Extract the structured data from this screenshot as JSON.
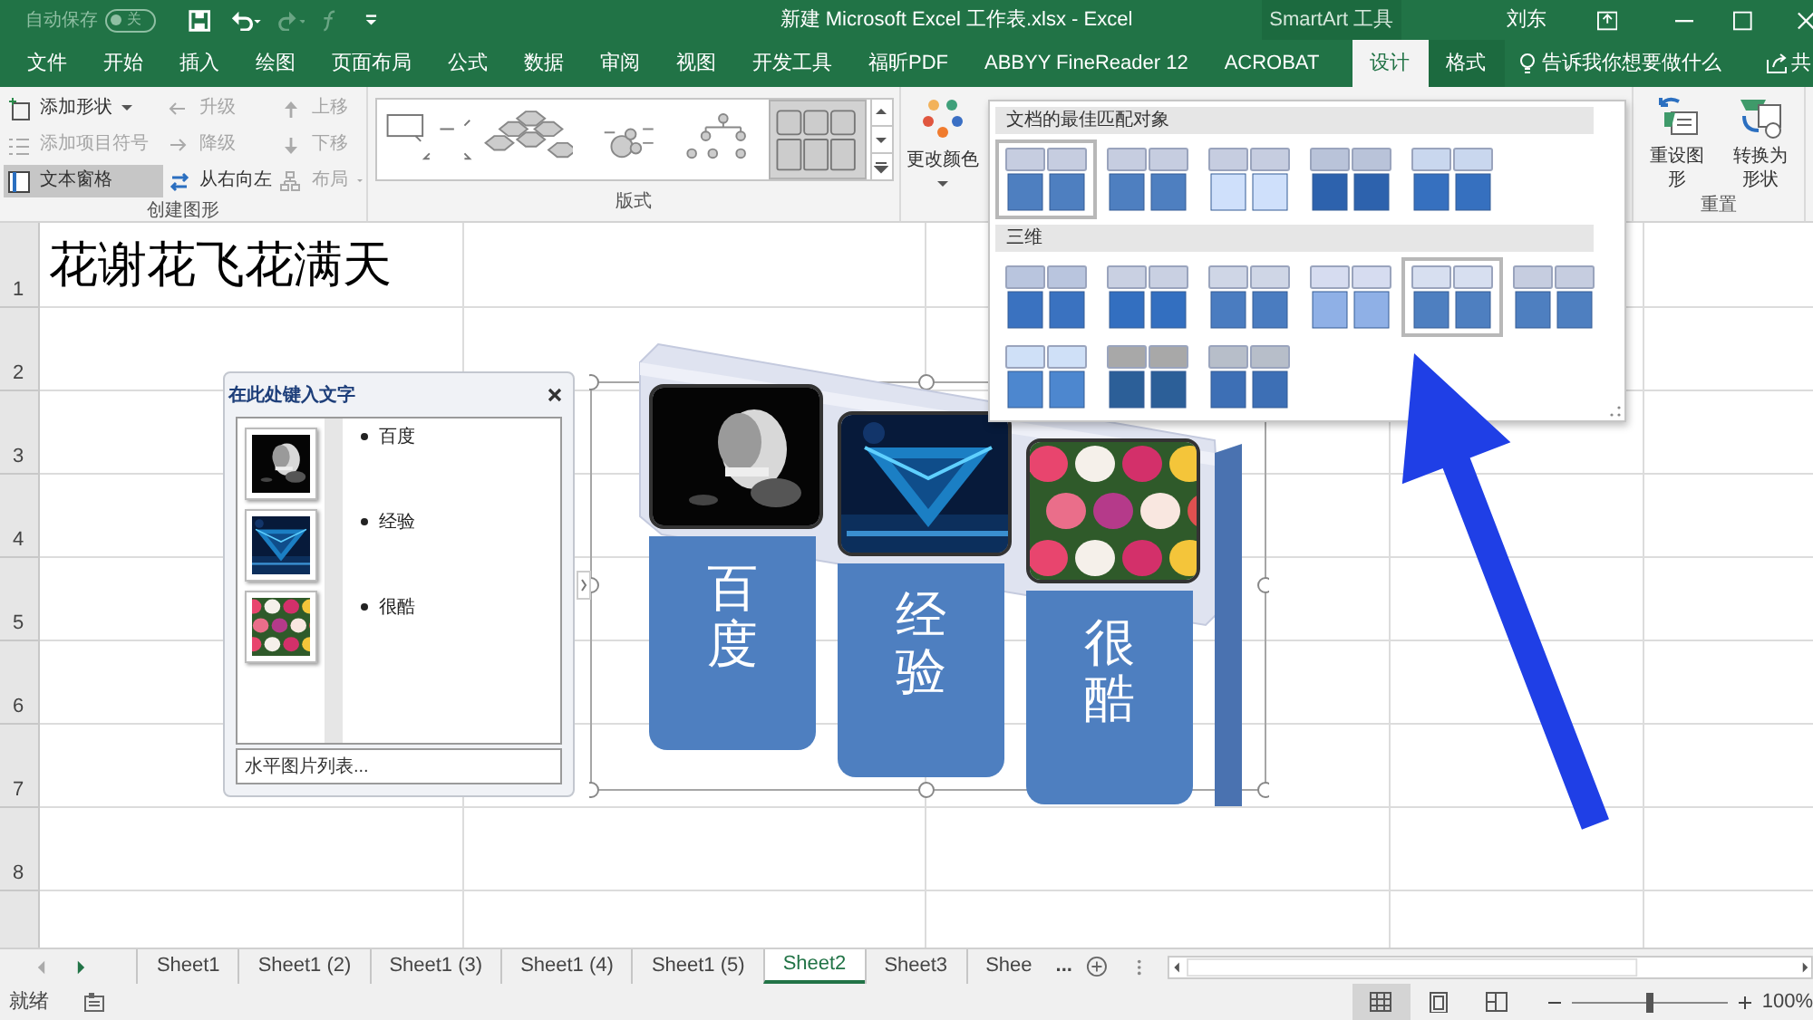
{
  "title_bar": {
    "autosave_label": "自动保存",
    "autosave_state": "关",
    "autosave_on": false,
    "title": "新建 Microsoft Excel 工作表.xlsx  -  Excel",
    "contextual_title": "SmartArt 工具",
    "user": "刘东"
  },
  "tabs": [
    {
      "label": "文件",
      "selected": false
    },
    {
      "label": "开始",
      "selected": false
    },
    {
      "label": "插入",
      "selected": false
    },
    {
      "label": "绘图",
      "selected": false
    },
    {
      "label": "页面布局",
      "selected": false
    },
    {
      "label": "公式",
      "selected": false
    },
    {
      "label": "数据",
      "selected": false
    },
    {
      "label": "审阅",
      "selected": false
    },
    {
      "label": "视图",
      "selected": false
    },
    {
      "label": "开发工具",
      "selected": false
    },
    {
      "label": "福昕PDF",
      "selected": false
    },
    {
      "label": "ABBYY FineReader 12",
      "selected": false
    },
    {
      "label": "ACROBAT",
      "selected": false
    }
  ],
  "contextual_tabs": [
    {
      "label": "设计",
      "selected": true
    },
    {
      "label": "格式",
      "selected": false
    }
  ],
  "tell_me": "告诉我你想要做什么",
  "share": "共",
  "ribbon": {
    "create_group": {
      "label": "创建图形",
      "commands": [
        {
          "label": "添加形状",
          "disabled": false,
          "on": false,
          "dropdown": true
        },
        {
          "label": "升级",
          "disabled": true,
          "on": false
        },
        {
          "label": "上移",
          "disabled": true,
          "on": false
        },
        {
          "label": "添加项目符号",
          "disabled": true,
          "on": false
        },
        {
          "label": "降级",
          "disabled": true,
          "on": false
        },
        {
          "label": "下移",
          "disabled": true,
          "on": false
        },
        {
          "label": "文本窗格",
          "disabled": false,
          "on": true
        },
        {
          "label": "从右向左",
          "disabled": false,
          "on": false
        },
        {
          "label": "布局",
          "disabled": true,
          "on": false,
          "dropdown": true
        }
      ]
    },
    "layout_group": {
      "label": "版式",
      "layouts": [
        {
          "selected": false
        },
        {
          "selected": false
        },
        {
          "selected": false
        },
        {
          "selected": false
        },
        {
          "selected": true
        }
      ]
    },
    "change_colors": "更改颜色",
    "reset_group": {
      "label": "重置",
      "commands": [
        "重设图形",
        "转换为形状"
      ]
    }
  },
  "style_gallery": {
    "sections": [
      {
        "title": "文档的最佳匹配对象",
        "styles": [
          {
            "selected": true
          },
          {
            "selected": false
          },
          {
            "selected": false
          },
          {
            "selected": false
          },
          {
            "selected": false
          }
        ]
      },
      {
        "title": "三维",
        "styles": [
          {
            "selected": false
          },
          {
            "selected": false
          },
          {
            "selected": false
          },
          {
            "selected": false
          },
          {
            "selected": true
          },
          {
            "selected": false
          },
          {
            "selected": false
          },
          {
            "selected": false
          },
          {
            "selected": false
          }
        ]
      }
    ]
  },
  "sheet": {
    "rows": [
      "1",
      "2",
      "3",
      "4",
      "5",
      "6",
      "7",
      "8"
    ],
    "cell_a1": "花谢花飞花满天"
  },
  "text_pane": {
    "title": "在此处键入文字",
    "items": [
      {
        "text": "百度"
      },
      {
        "text": "经验"
      },
      {
        "text": "很酷"
      }
    ],
    "footer": "水平图片列表..."
  },
  "smartart": {
    "items": [
      {
        "text": "百度"
      },
      {
        "text": "经验"
      },
      {
        "text": "很酷"
      }
    ]
  },
  "sheet_tabs": [
    {
      "label": "Sheet1",
      "selected": false
    },
    {
      "label": "Sheet1 (2)",
      "selected": false
    },
    {
      "label": "Sheet1 (3)",
      "selected": false
    },
    {
      "label": "Sheet1 (4)",
      "selected": false
    },
    {
      "label": "Sheet1 (5)",
      "selected": false
    },
    {
      "label": "Sheet2",
      "selected": true
    },
    {
      "label": "Sheet3",
      "selected": false
    },
    {
      "label": "Shee",
      "selected": false
    }
  ],
  "more_sheets": "...",
  "status_bar": {
    "status": "就绪",
    "views": [
      {
        "selected": true
      },
      {
        "selected": false
      },
      {
        "selected": false
      }
    ],
    "zoom": {
      "level": 0.5
    },
    "zoom_text": "100%"
  }
}
